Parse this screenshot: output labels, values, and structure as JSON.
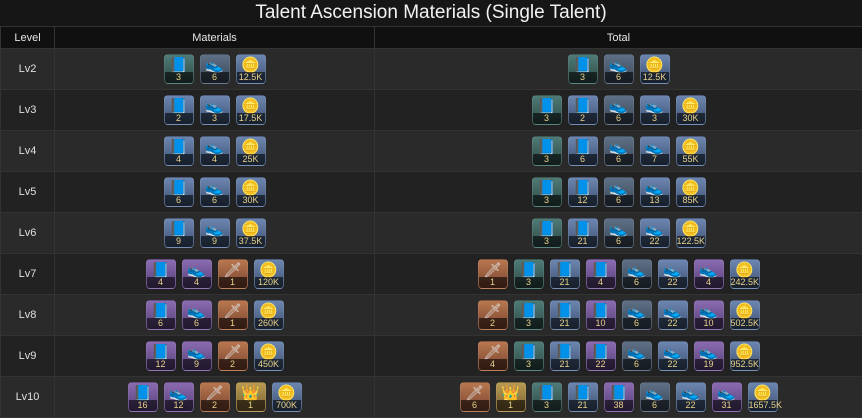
{
  "title": "Talent Ascension Materials (Single Talent)",
  "headers": {
    "level": "Level",
    "materials": "Materials",
    "total": "Total"
  },
  "icons": {
    "book": "📘",
    "shoe": "👟",
    "coin": "🪙",
    "sword": "🗡",
    "crown": "👑"
  },
  "rows": [
    {
      "level": "Lv2",
      "materials": [
        {
          "icon": "book",
          "bg": "teal",
          "count": "3"
        },
        {
          "icon": "shoe",
          "bg": "slate",
          "count": "6"
        },
        {
          "icon": "coin",
          "bg": "blue",
          "count": "12.5K"
        }
      ],
      "total": [
        {
          "icon": "book",
          "bg": "teal",
          "count": "3"
        },
        {
          "icon": "shoe",
          "bg": "slate",
          "count": "6"
        },
        {
          "icon": "coin",
          "bg": "blue",
          "count": "12.5K"
        }
      ]
    },
    {
      "level": "Lv3",
      "materials": [
        {
          "icon": "book",
          "bg": "blue",
          "count": "2"
        },
        {
          "icon": "shoe",
          "bg": "blue",
          "count": "3"
        },
        {
          "icon": "coin",
          "bg": "blue",
          "count": "17.5K"
        }
      ],
      "total": [
        {
          "icon": "book",
          "bg": "teal",
          "count": "3"
        },
        {
          "icon": "book",
          "bg": "blue",
          "count": "2"
        },
        {
          "icon": "shoe",
          "bg": "slate",
          "count": "6"
        },
        {
          "icon": "shoe",
          "bg": "blue",
          "count": "3"
        },
        {
          "icon": "coin",
          "bg": "blue",
          "count": "30K"
        }
      ]
    },
    {
      "level": "Lv4",
      "materials": [
        {
          "icon": "book",
          "bg": "blue",
          "count": "4"
        },
        {
          "icon": "shoe",
          "bg": "blue",
          "count": "4"
        },
        {
          "icon": "coin",
          "bg": "blue",
          "count": "25K"
        }
      ],
      "total": [
        {
          "icon": "book",
          "bg": "teal",
          "count": "3"
        },
        {
          "icon": "book",
          "bg": "blue",
          "count": "6"
        },
        {
          "icon": "shoe",
          "bg": "slate",
          "count": "6"
        },
        {
          "icon": "shoe",
          "bg": "blue",
          "count": "7"
        },
        {
          "icon": "coin",
          "bg": "blue",
          "count": "55K"
        }
      ]
    },
    {
      "level": "Lv5",
      "materials": [
        {
          "icon": "book",
          "bg": "blue",
          "count": "6"
        },
        {
          "icon": "shoe",
          "bg": "blue",
          "count": "6"
        },
        {
          "icon": "coin",
          "bg": "blue",
          "count": "30K"
        }
      ],
      "total": [
        {
          "icon": "book",
          "bg": "teal",
          "count": "3"
        },
        {
          "icon": "book",
          "bg": "blue",
          "count": "12"
        },
        {
          "icon": "shoe",
          "bg": "slate",
          "count": "6"
        },
        {
          "icon": "shoe",
          "bg": "blue",
          "count": "13"
        },
        {
          "icon": "coin",
          "bg": "blue",
          "count": "85K"
        }
      ]
    },
    {
      "level": "Lv6",
      "materials": [
        {
          "icon": "book",
          "bg": "blue",
          "count": "9"
        },
        {
          "icon": "shoe",
          "bg": "blue",
          "count": "9"
        },
        {
          "icon": "coin",
          "bg": "blue",
          "count": "37.5K"
        }
      ],
      "total": [
        {
          "icon": "book",
          "bg": "teal",
          "count": "3"
        },
        {
          "icon": "book",
          "bg": "blue",
          "count": "21"
        },
        {
          "icon": "shoe",
          "bg": "slate",
          "count": "6"
        },
        {
          "icon": "shoe",
          "bg": "blue",
          "count": "22"
        },
        {
          "icon": "coin",
          "bg": "blue",
          "count": "122.5K"
        }
      ]
    },
    {
      "level": "Lv7",
      "materials": [
        {
          "icon": "book",
          "bg": "purple",
          "count": "4"
        },
        {
          "icon": "shoe",
          "bg": "purple",
          "count": "4"
        },
        {
          "icon": "sword",
          "bg": "orange",
          "count": "1"
        },
        {
          "icon": "coin",
          "bg": "blue",
          "count": "120K"
        }
      ],
      "total": [
        {
          "icon": "sword",
          "bg": "orange",
          "count": "1"
        },
        {
          "icon": "book",
          "bg": "teal",
          "count": "3"
        },
        {
          "icon": "book",
          "bg": "blue",
          "count": "21"
        },
        {
          "icon": "book",
          "bg": "purple",
          "count": "4"
        },
        {
          "icon": "shoe",
          "bg": "slate",
          "count": "6"
        },
        {
          "icon": "shoe",
          "bg": "blue",
          "count": "22"
        },
        {
          "icon": "shoe",
          "bg": "purple",
          "count": "4"
        },
        {
          "icon": "coin",
          "bg": "blue",
          "count": "242.5K"
        }
      ]
    },
    {
      "level": "Lv8",
      "materials": [
        {
          "icon": "book",
          "bg": "purple",
          "count": "6"
        },
        {
          "icon": "shoe",
          "bg": "purple",
          "count": "6"
        },
        {
          "icon": "sword",
          "bg": "orange",
          "count": "1"
        },
        {
          "icon": "coin",
          "bg": "blue",
          "count": "260K"
        }
      ],
      "total": [
        {
          "icon": "sword",
          "bg": "orange",
          "count": "2"
        },
        {
          "icon": "book",
          "bg": "teal",
          "count": "3"
        },
        {
          "icon": "book",
          "bg": "blue",
          "count": "21"
        },
        {
          "icon": "book",
          "bg": "purple",
          "count": "10"
        },
        {
          "icon": "shoe",
          "bg": "slate",
          "count": "6"
        },
        {
          "icon": "shoe",
          "bg": "blue",
          "count": "22"
        },
        {
          "icon": "shoe",
          "bg": "purple",
          "count": "10"
        },
        {
          "icon": "coin",
          "bg": "blue",
          "count": "502.5K"
        }
      ]
    },
    {
      "level": "Lv9",
      "materials": [
        {
          "icon": "book",
          "bg": "purple",
          "count": "12"
        },
        {
          "icon": "shoe",
          "bg": "purple",
          "count": "9"
        },
        {
          "icon": "sword",
          "bg": "orange",
          "count": "2"
        },
        {
          "icon": "coin",
          "bg": "blue",
          "count": "450K"
        }
      ],
      "total": [
        {
          "icon": "sword",
          "bg": "orange",
          "count": "4"
        },
        {
          "icon": "book",
          "bg": "teal",
          "count": "3"
        },
        {
          "icon": "book",
          "bg": "blue",
          "count": "21"
        },
        {
          "icon": "book",
          "bg": "purple",
          "count": "22"
        },
        {
          "icon": "shoe",
          "bg": "slate",
          "count": "6"
        },
        {
          "icon": "shoe",
          "bg": "blue",
          "count": "22"
        },
        {
          "icon": "shoe",
          "bg": "purple",
          "count": "19"
        },
        {
          "icon": "coin",
          "bg": "blue",
          "count": "952.5K"
        }
      ]
    },
    {
      "level": "Lv10",
      "materials": [
        {
          "icon": "book",
          "bg": "purple",
          "count": "16"
        },
        {
          "icon": "shoe",
          "bg": "purple",
          "count": "12"
        },
        {
          "icon": "sword",
          "bg": "orange",
          "count": "2"
        },
        {
          "icon": "crown",
          "bg": "gold",
          "count": "1"
        },
        {
          "icon": "coin",
          "bg": "blue",
          "count": "700K"
        }
      ],
      "total": [
        {
          "icon": "sword",
          "bg": "orange",
          "count": "6"
        },
        {
          "icon": "crown",
          "bg": "gold",
          "count": "1"
        },
        {
          "icon": "book",
          "bg": "teal",
          "count": "3"
        },
        {
          "icon": "book",
          "bg": "blue",
          "count": "21"
        },
        {
          "icon": "book",
          "bg": "purple",
          "count": "38"
        },
        {
          "icon": "shoe",
          "bg": "slate",
          "count": "6"
        },
        {
          "icon": "shoe",
          "bg": "blue",
          "count": "22"
        },
        {
          "icon": "shoe",
          "bg": "purple",
          "count": "31"
        },
        {
          "icon": "coin",
          "bg": "blue",
          "count": "1657.5K"
        }
      ]
    }
  ]
}
